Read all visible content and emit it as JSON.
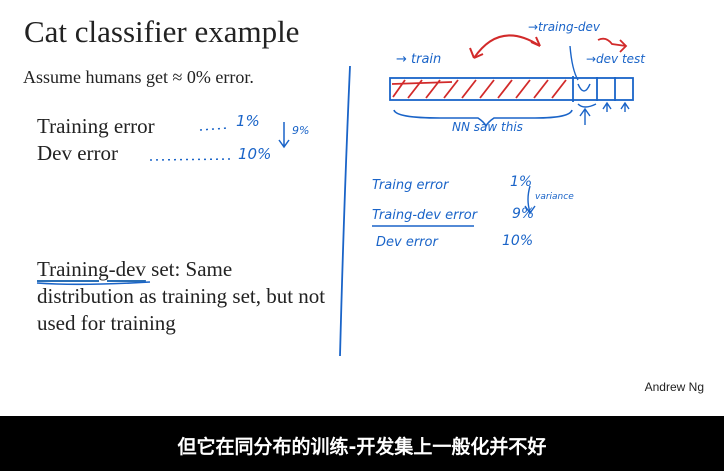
{
  "slide": {
    "title": "Cat classifier example",
    "assumption": "Assume humans get ≈ 0% error.",
    "training_error_label": "Training error",
    "dev_error_label": "Dev error",
    "training_error_note": "1%",
    "dev_error_note": "10%",
    "gap_note": "9%",
    "training_dev_term": "Training-dev",
    "training_dev_rest": " set: Same distribution as training set, but not used for training",
    "author": "Andrew Ng"
  },
  "annotations": {
    "train_label": "→ train",
    "training_dev_label": "→traing-dev",
    "dev_test_label": "→dev test",
    "nn_saw_this": "NN saw this",
    "variance_label": "variance",
    "table": [
      {
        "label": "Traing error",
        "value": "1%"
      },
      {
        "label": "Traing-dev error",
        "value": "9%"
      },
      {
        "label": "Dev error",
        "value": "10%"
      }
    ]
  },
  "subtitle": "但它在同分布的训练-开发集上一般化并不好",
  "colors": {
    "ink_blue": "#1a64c8",
    "ink_red": "#d22a2a",
    "caption_bg": "#000000"
  }
}
